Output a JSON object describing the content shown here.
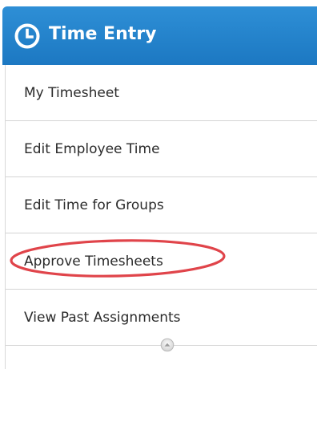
{
  "header": {
    "title": "Time Entry",
    "icon": "clock-icon",
    "background_color": "#1f7dc5"
  },
  "menu": {
    "items": [
      {
        "label": "My Timesheet"
      },
      {
        "label": "Edit Employee Time"
      },
      {
        "label": "Edit Time for Groups"
      },
      {
        "label": "Approve Timesheets",
        "highlighted": true,
        "highlight_color": "#e0444a"
      },
      {
        "label": "View Past Assignments"
      }
    ]
  },
  "scroll": {
    "icon": "scroll-up-icon"
  }
}
